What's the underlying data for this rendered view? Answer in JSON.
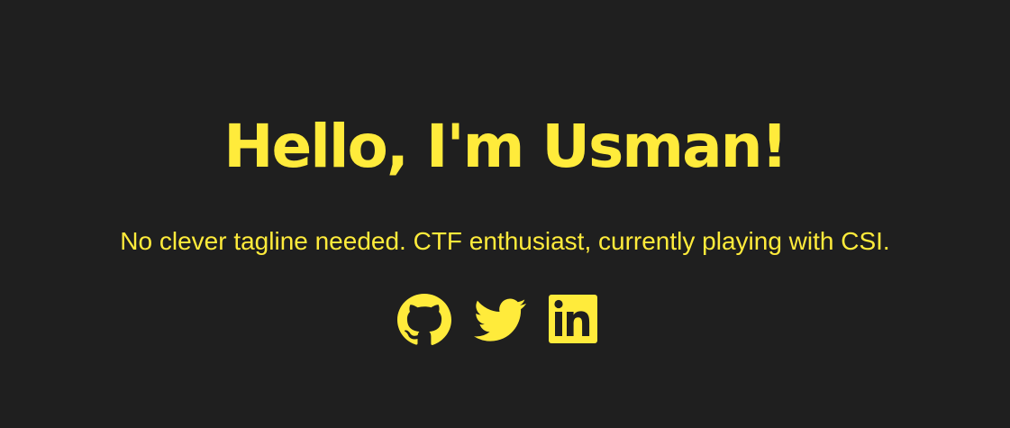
{
  "hero": {
    "title": "Hello, I'm Usman!",
    "tagline": "No clever tagline needed. CTF enthusiast, currently playing with CSI."
  },
  "socials": [
    {
      "name": "GitHub",
      "icon": "github-icon"
    },
    {
      "name": "Twitter",
      "icon": "twitter-icon"
    },
    {
      "name": "LinkedIn",
      "icon": "linkedin-icon"
    }
  ],
  "colors": {
    "background": "#1f1f1f",
    "accent": "#ffeb3b"
  }
}
